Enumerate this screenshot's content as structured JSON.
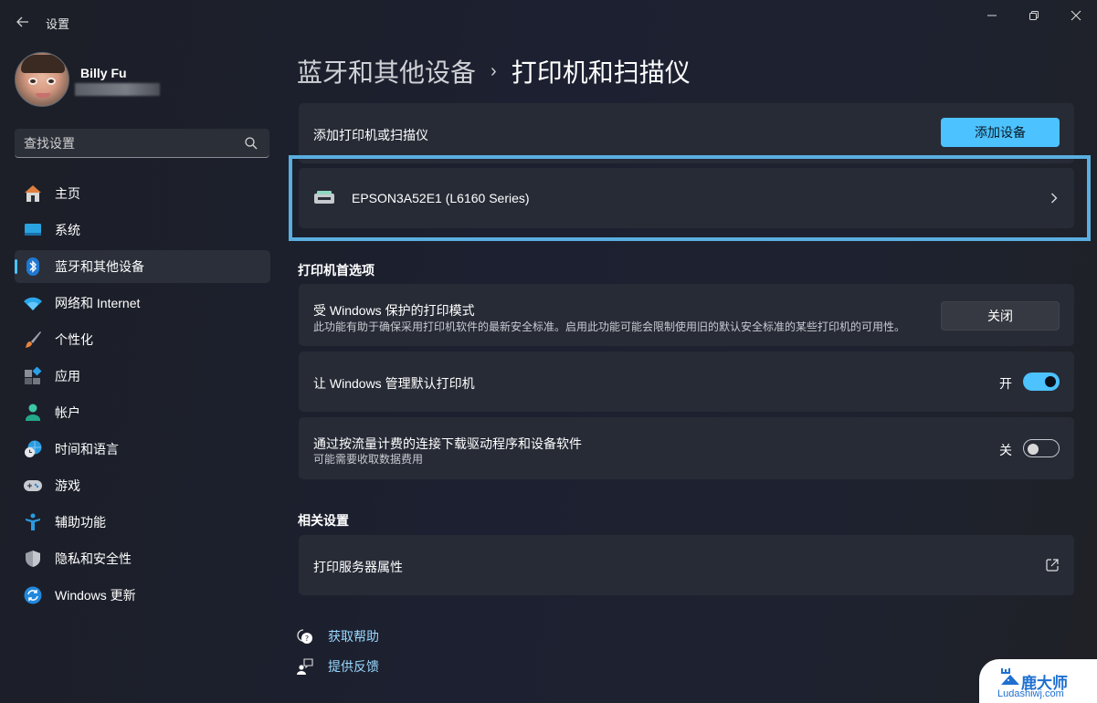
{
  "window": {
    "title": "设置",
    "back_icon": "arrow-left-icon",
    "controls": [
      "minimize-icon",
      "restore-icon",
      "close-icon"
    ]
  },
  "profile": {
    "name": "Billy Fu",
    "email_redacted": true
  },
  "search": {
    "placeholder": "查找设置",
    "value": "",
    "icon": "search-icon"
  },
  "sidebar": {
    "items": [
      {
        "label": "主页",
        "icon": "home-icon",
        "active": false
      },
      {
        "label": "系统",
        "icon": "system-display-icon",
        "active": false
      },
      {
        "label": "蓝牙和其他设备",
        "icon": "bluetooth-icon",
        "active": true
      },
      {
        "label": "网络和 Internet",
        "icon": "wifi-icon",
        "active": false
      },
      {
        "label": "个性化",
        "icon": "paintbrush-icon",
        "active": false
      },
      {
        "label": "应用",
        "icon": "apps-icon",
        "active": false
      },
      {
        "label": "帐户",
        "icon": "account-icon",
        "active": false
      },
      {
        "label": "时间和语言",
        "icon": "time-language-icon",
        "active": false
      },
      {
        "label": "游戏",
        "icon": "gamepad-icon",
        "active": false
      },
      {
        "label": "辅助功能",
        "icon": "accessibility-icon",
        "active": false
      },
      {
        "label": "隐私和安全性",
        "icon": "shield-icon",
        "active": false
      },
      {
        "label": "Windows 更新",
        "icon": "windows-update-icon",
        "active": false
      }
    ]
  },
  "main": {
    "breadcrumb": {
      "parent": "蓝牙和其他设备",
      "separator": "›",
      "current": "打印机和扫描仪"
    },
    "add_card": {
      "label": "添加打印机或扫描仪",
      "button": "添加设备"
    },
    "printer": {
      "name": "EPSON3A52E1 (L6160 Series)",
      "icon": "printer-icon",
      "chevron": "chevron-right-icon"
    },
    "preferences": {
      "heading": "打印机首选项",
      "protected_mode": {
        "title": "受 Windows 保护的打印模式",
        "description": "此功能有助于确保采用打印机软件的最新安全标准。启用此功能可能会限制使用旧的默认安全标准的某些打印机的可用性。",
        "button": "关闭"
      },
      "manage_default": {
        "title": "让 Windows 管理默认打印机",
        "state_label": "开",
        "on": true
      },
      "metered_download": {
        "title": "通过按流量计费的连接下载驱动程序和设备软件",
        "description": "可能需要收取数据费用",
        "state_label": "关",
        "on": false
      }
    },
    "related": {
      "heading": "相关设置",
      "print_server": {
        "title": "打印服务器属性",
        "icon": "open-external-icon"
      }
    },
    "help_links": [
      {
        "label": "获取帮助",
        "icon": "help-icon"
      },
      {
        "label": "提供反馈",
        "icon": "feedback-icon"
      }
    ]
  },
  "watermark": {
    "brand": "鹿大师",
    "url": "Ludashiwj.com"
  },
  "colors": {
    "accent": "#4cc2ff",
    "focus_frame": "#5aaee0",
    "card_bg": "#272b36",
    "link": "#99d8ff"
  }
}
